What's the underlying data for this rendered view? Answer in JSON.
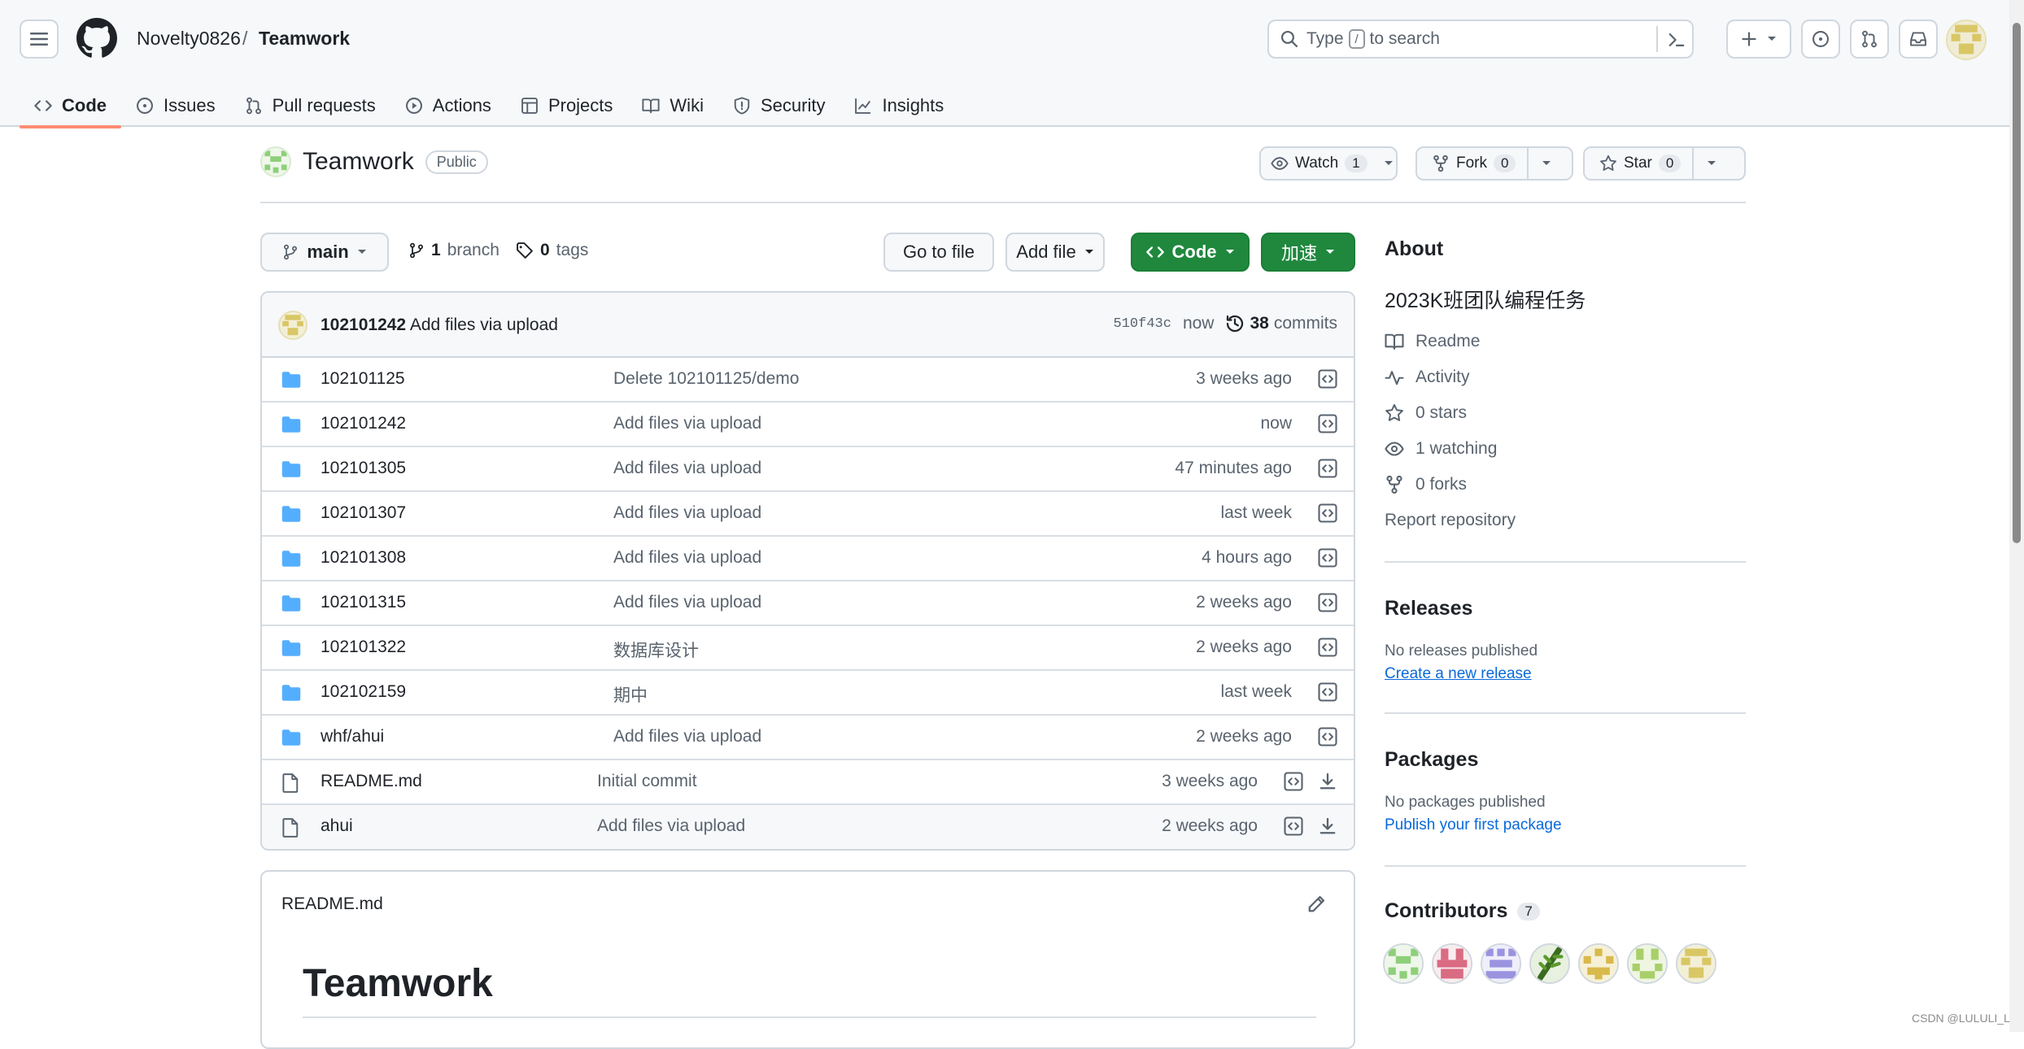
{
  "header": {
    "owner": "Novelty0826",
    "separator": "/",
    "repo": "Teamwork",
    "search_type": "Type",
    "search_key": "/",
    "search_suffix": "to search"
  },
  "tabs": [
    {
      "label": "Code",
      "icon": "code-icon"
    },
    {
      "label": "Issues",
      "icon": "issue-icon"
    },
    {
      "label": "Pull requests",
      "icon": "pull-request-icon"
    },
    {
      "label": "Actions",
      "icon": "play-icon"
    },
    {
      "label": "Projects",
      "icon": "table-icon"
    },
    {
      "label": "Wiki",
      "icon": "book-icon"
    },
    {
      "label": "Security",
      "icon": "shield-icon"
    },
    {
      "label": "Insights",
      "icon": "graph-icon"
    }
  ],
  "repo": {
    "name": "Teamwork",
    "visibility": "Public",
    "watch_label": "Watch",
    "watch_count": "1",
    "fork_label": "Fork",
    "fork_count": "0",
    "star_label": "Star",
    "star_count": "0"
  },
  "toolbar": {
    "branch": "main",
    "branch_count": "1",
    "branch_label": "branch",
    "tag_count": "0",
    "tag_label": "tags",
    "go_to_file": "Go to file",
    "add_file": "Add file",
    "code": "Code",
    "accelerate": "加速"
  },
  "latest_commit": {
    "author": "102101242",
    "message": "Add files via upload",
    "sha": "510f43c",
    "age": "now",
    "commit_count": "38",
    "commit_label": "commits"
  },
  "files": [
    {
      "type": "dir",
      "name": "102101125",
      "message": "Delete 102101125/demo",
      "age": "3 weeks ago"
    },
    {
      "type": "dir",
      "name": "102101242",
      "message": "Add files via upload",
      "age": "now"
    },
    {
      "type": "dir",
      "name": "102101305",
      "message": "Add files via upload",
      "age": "47 minutes ago"
    },
    {
      "type": "dir",
      "name": "102101307",
      "message": "Add files via upload",
      "age": "last week"
    },
    {
      "type": "dir",
      "name": "102101308",
      "message": "Add files via upload",
      "age": "4 hours ago"
    },
    {
      "type": "dir",
      "name": "102101315",
      "message": "Add files via upload",
      "age": "2 weeks ago"
    },
    {
      "type": "dir",
      "name": "102101322",
      "message": "数据库设计",
      "age": "2 weeks ago"
    },
    {
      "type": "dir",
      "name": "102102159",
      "message": "期中",
      "age": "last week"
    },
    {
      "type": "dir",
      "name": "whf/ahui",
      "message": "Add files via upload",
      "age": "2 weeks ago"
    },
    {
      "type": "file",
      "name": "README.md",
      "message": "Initial commit",
      "age": "3 weeks ago"
    },
    {
      "type": "file",
      "name": "ahui",
      "message": "Add files via upload",
      "age": "2 weeks ago"
    }
  ],
  "readme": {
    "filename": "README.md",
    "title": "Teamwork"
  },
  "sidebar": {
    "about_heading": "About",
    "description": "2023K班团队编程任务",
    "links": [
      {
        "label": "Readme",
        "icon": "book-icon"
      },
      {
        "label": "Activity",
        "icon": "pulse-icon"
      },
      {
        "label": "0 stars",
        "icon": "star-icon"
      },
      {
        "label": "1 watching",
        "icon": "eye-icon"
      },
      {
        "label": "0 forks",
        "icon": "fork-icon"
      }
    ],
    "report": "Report repository",
    "releases_heading": "Releases",
    "releases_none": "No releases published",
    "releases_link": "Create a new release",
    "packages_heading": "Packages",
    "packages_none": "No packages published",
    "packages_link": "Publish your first package",
    "contributors_heading": "Contributors",
    "contributors_count": "7"
  },
  "colors": {
    "accent_green": "#1f883d",
    "link_blue": "#0969da",
    "folder_blue": "#54aeff",
    "tab_underline": "#fd8c73"
  },
  "watermark": "CSDN @LULULI_L"
}
